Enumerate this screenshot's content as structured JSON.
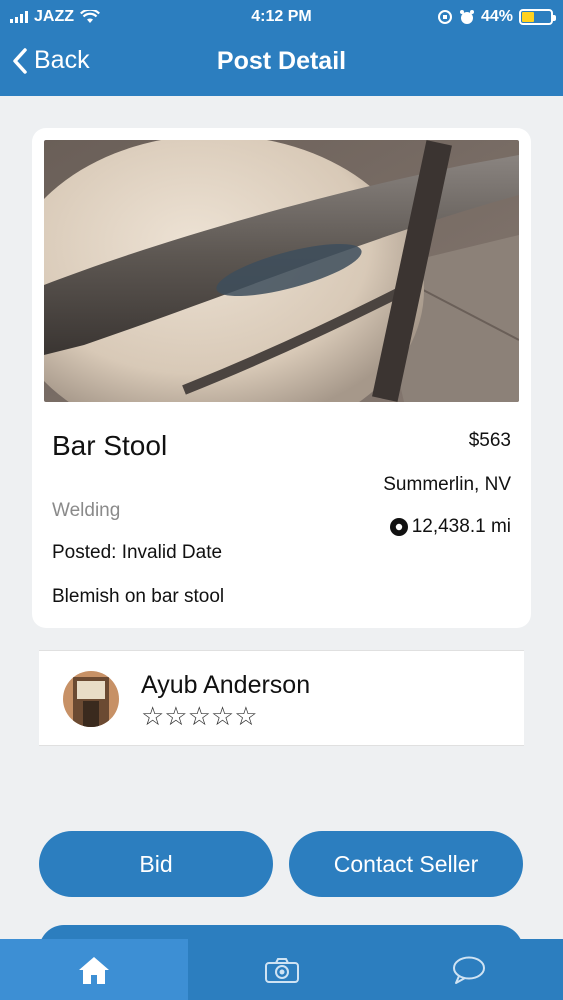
{
  "status_bar": {
    "carrier": "JAZZ",
    "time": "4:12 PM",
    "battery": "44%",
    "battery_level": 0.44
  },
  "nav": {
    "back_label": "Back",
    "title": "Post Detail"
  },
  "post": {
    "title": "Bar Stool",
    "price": "$563",
    "location": "Summerlin, NV",
    "category": "Welding",
    "distance": "12,438.1 mi",
    "posted": "Posted: Invalid Date",
    "description": "Blemish on bar stool"
  },
  "seller": {
    "name": "Ayub Anderson",
    "rating": 0,
    "stars": "☆☆☆☆☆"
  },
  "actions": {
    "bid_label": "Bid",
    "contact_label": "Contact Seller"
  },
  "tabbar": {
    "items": [
      {
        "icon": "home-icon",
        "active": true
      },
      {
        "icon": "camera-icon",
        "active": false
      },
      {
        "icon": "chat-icon",
        "active": false
      }
    ]
  },
  "colors": {
    "primary": "#2c7ebf",
    "background": "#eef0f2",
    "muted_text": "#8a8a8a"
  }
}
